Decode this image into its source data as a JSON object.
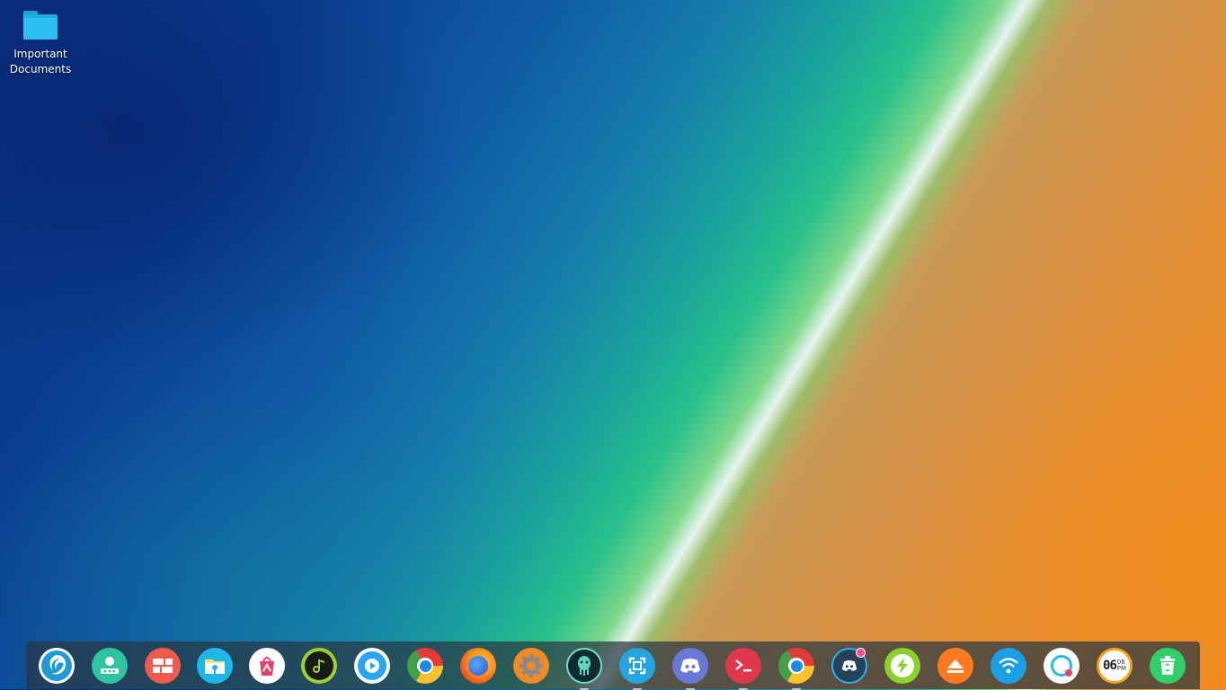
{
  "desktop": {
    "icons": [
      {
        "label": "Important Documents",
        "icon": "folder-icon"
      }
    ]
  },
  "dock": {
    "items": [
      {
        "name": "launcher",
        "icon": "deepin-launcher-icon",
        "color": "#1e9bd7"
      },
      {
        "name": "app-store",
        "icon": "app-store-icon",
        "color": "#2fc4a0"
      },
      {
        "name": "multitasking-view",
        "icon": "multitask-icon",
        "color": "#ef5a4c"
      },
      {
        "name": "file-manager",
        "icon": "file-manager-icon",
        "color": "#1db8e8"
      },
      {
        "name": "deepin-store",
        "icon": "store-bag-icon",
        "color": "#e93f6f"
      },
      {
        "name": "music",
        "icon": "music-icon",
        "color": "#9ad12b"
      },
      {
        "name": "movie-player",
        "icon": "movie-icon",
        "color": "#2aa6f0"
      },
      {
        "name": "chrome",
        "icon": "chrome-icon",
        "color": "#e53935"
      },
      {
        "name": "firefox",
        "icon": "firefox-icon",
        "color": "#ff6b1a"
      },
      {
        "name": "settings",
        "icon": "gear-icon",
        "color": "#f08a24"
      },
      {
        "name": "gitkraken",
        "icon": "gitkraken-icon",
        "color": "#0f3d45"
      },
      {
        "name": "screenshot",
        "icon": "screenshot-icon",
        "color": "#25a4e0"
      },
      {
        "name": "discord",
        "icon": "discord-icon",
        "color": "#6a76d8"
      },
      {
        "name": "terminal",
        "icon": "terminal-icon",
        "color": "#e0384a"
      },
      {
        "name": "chrome-2",
        "icon": "chrome-icon",
        "color": "#e53935"
      },
      {
        "name": "discord-notify",
        "icon": "discord-icon",
        "color": "#2a4a60"
      },
      {
        "name": "power",
        "icon": "power-bolt-icon",
        "color": "#8bd12a"
      },
      {
        "name": "eject",
        "icon": "eject-icon",
        "color": "#ff7a1e"
      },
      {
        "name": "network",
        "icon": "wifi-icon",
        "color": "#1a9fe6"
      },
      {
        "name": "notifications",
        "icon": "notification-icon",
        "color": "#28b8e8"
      },
      {
        "name": "clock",
        "icon": "clock-icon",
        "color": "#f5a21e"
      },
      {
        "name": "trash",
        "icon": "trash-icon",
        "color": "#2fcf6a"
      }
    ],
    "clock": {
      "hour": "06",
      "minute": "06",
      "ampm": "PM"
    }
  }
}
